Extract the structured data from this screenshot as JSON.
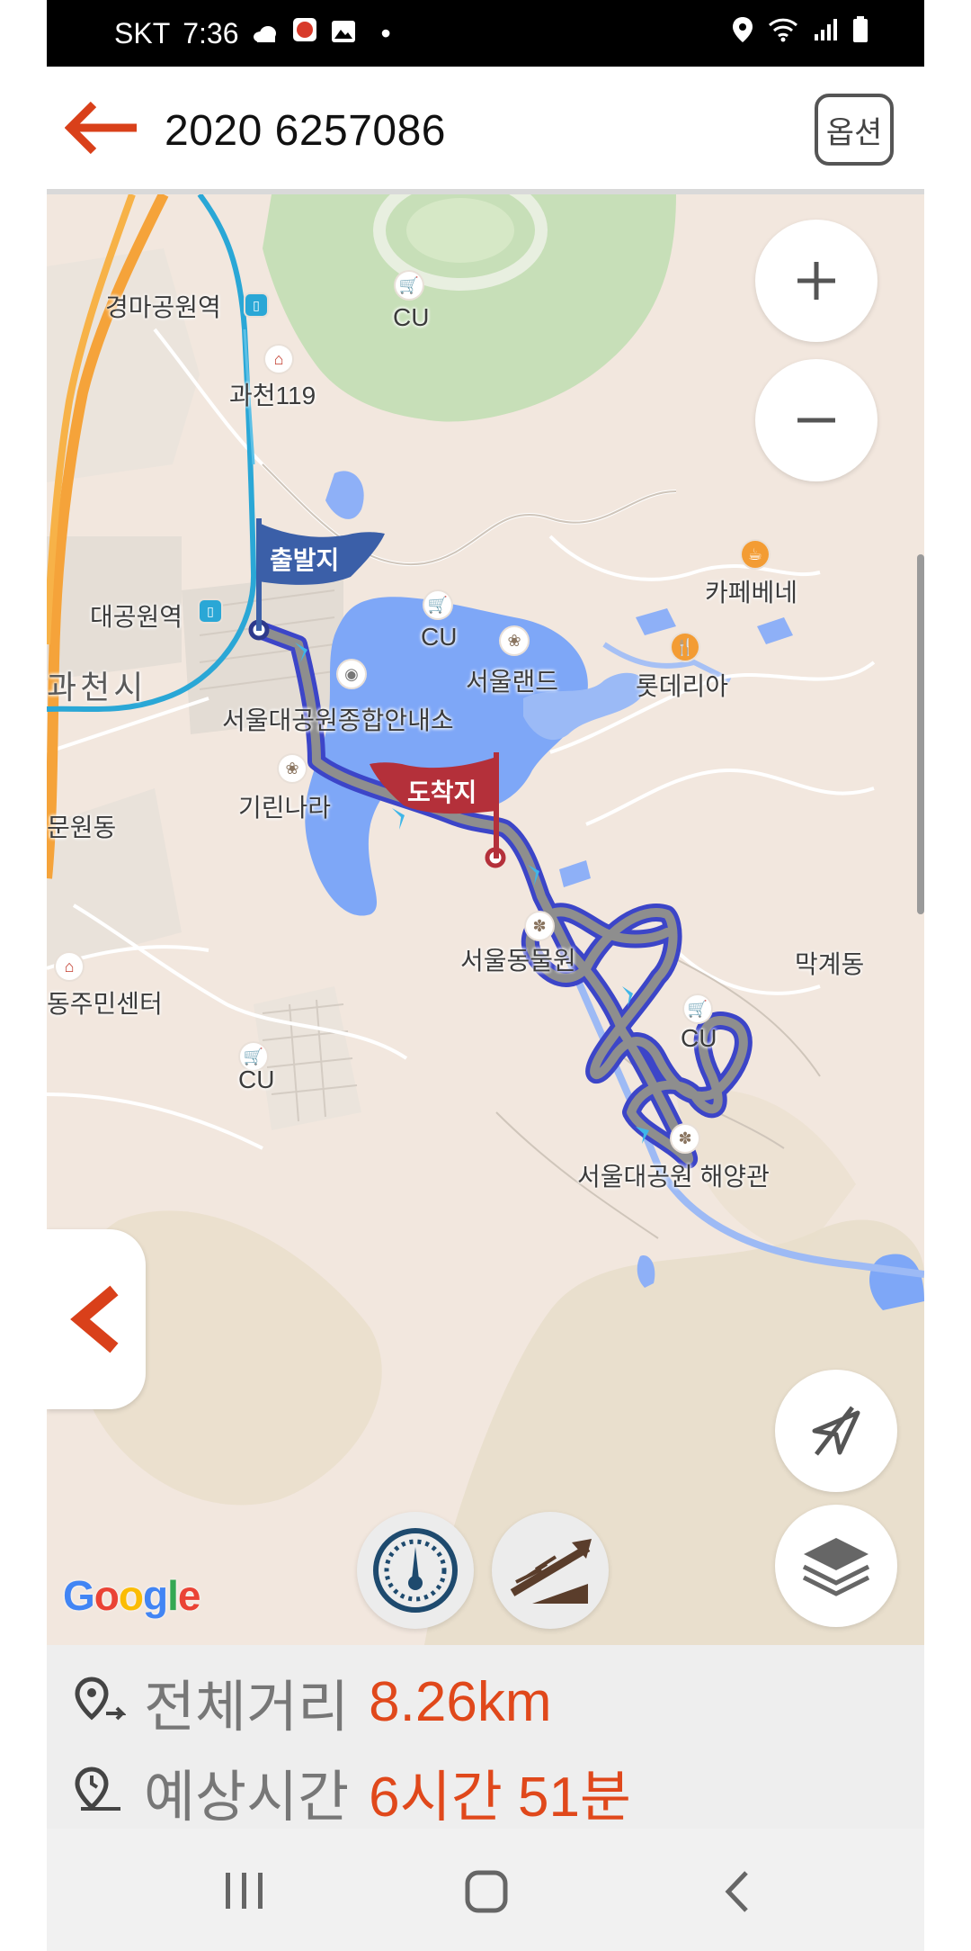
{
  "status_bar": {
    "carrier": "SKT",
    "time": "7:36",
    "notification_dot": "•"
  },
  "header": {
    "title": "2020 6257086",
    "option_label": "옵션"
  },
  "map": {
    "labels": {
      "gyeongma_station": "경마공원역",
      "cu_1": "CU",
      "gwacheon119": "과천119",
      "daegongwon_station": "대공원역",
      "gwacheon_city": "과천시",
      "visitor_center": "서울대공원종합안내소",
      "girin": "기린나라",
      "cu_2": "CU",
      "seoulland": "서울랜드",
      "cafe_bene": "카페베네",
      "lotteria": "롯데리아",
      "munwon": "문원동",
      "community_center": "동주민센터",
      "cu_3": "CU",
      "zoo": "서울동물원",
      "makgye": "막계동",
      "cu_4": "CU",
      "aquarium": "서울대공원 해양관"
    },
    "start_flag": "출발지",
    "end_flag": "도착지",
    "attribution": "Google",
    "controls": [
      "zoom-in",
      "zoom-out",
      "compass",
      "layers",
      "speedometer",
      "elevation"
    ]
  },
  "route_info": {
    "distance_label": "전체거리",
    "distance_value": "8.26km",
    "time_label": "예상시간",
    "time_value": "6시간 51분"
  },
  "colors": {
    "accent": "#e0481b",
    "route": "#3c45c8",
    "start_flag": "#3b5fa8",
    "end_flag": "#b4303a"
  }
}
